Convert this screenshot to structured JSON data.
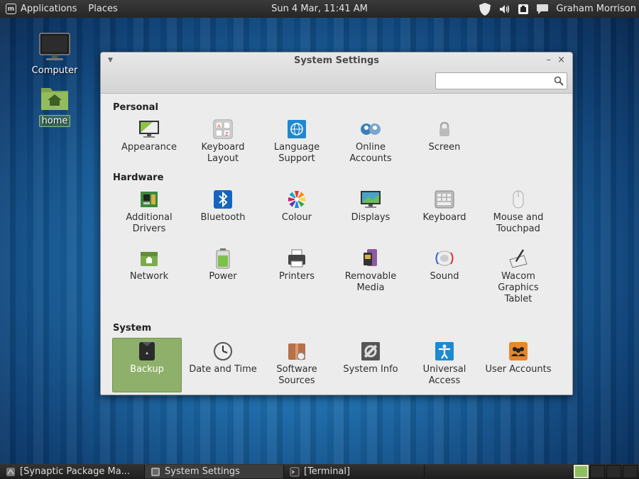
{
  "top_panel": {
    "applications": "Applications",
    "places": "Places",
    "clock": "Sun  4 Mar, 11:41 AM",
    "user": "Graham Morrison"
  },
  "desktop": {
    "computer": "Computer",
    "home": "home"
  },
  "window": {
    "title": "System Settings",
    "search_placeholder": "",
    "sections": {
      "personal": {
        "title": "Personal",
        "items": [
          "Appearance",
          "Keyboard Layout",
          "Language Support",
          "Online Accounts",
          "Screen"
        ]
      },
      "hardware": {
        "title": "Hardware",
        "items": [
          "Additional Drivers",
          "Bluetooth",
          "Colour",
          "Displays",
          "Keyboard",
          "Mouse and Touchpad",
          "Network",
          "Power",
          "Printers",
          "Removable Media",
          "Sound",
          "Wacom Graphics Tablet"
        ]
      },
      "system": {
        "title": "System",
        "items": [
          "Backup",
          "Date and Time",
          "Software Sources",
          "System Info",
          "Universal Access",
          "User Accounts"
        ],
        "selected": "Backup"
      }
    }
  },
  "taskbar": {
    "tasks": [
      "[Synaptic Package Ma...",
      "System Settings",
      "[Terminal]"
    ]
  },
  "colors": {
    "selection": "#8fb06a",
    "desktop_blue": "#1c6aa8"
  }
}
